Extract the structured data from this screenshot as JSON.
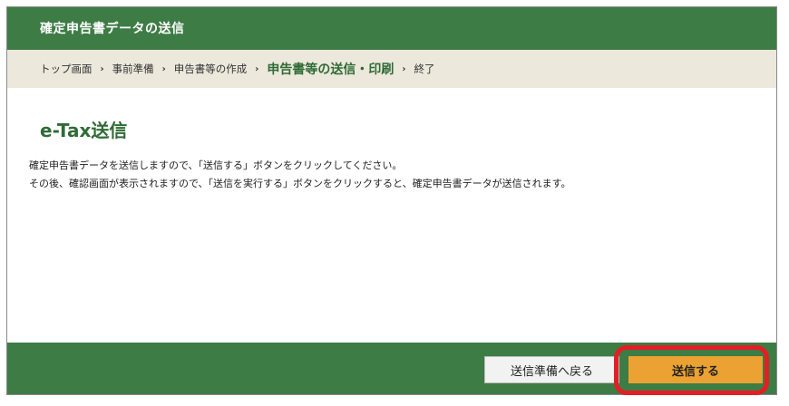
{
  "header": {
    "title": "確定申告書データの送信"
  },
  "breadcrumb": {
    "items": [
      {
        "label": "トップ画面"
      },
      {
        "label": "事前準備"
      },
      {
        "label": "申告書等の作成"
      },
      {
        "label": "申告書等の送信・印刷"
      },
      {
        "label": "終了"
      }
    ],
    "separator": "›",
    "current_index": 3
  },
  "main": {
    "title": "e-Tax送信",
    "paragraphs": [
      "確定申告書データを送信しますので、「送信する」ボタンをクリックしてください。",
      "その後、確認画面が表示されますので、「送信を実行する」ボタンをクリックすると、確定申告書データが送信されます。"
    ]
  },
  "footer": {
    "back_label": "送信準備へ戻る",
    "send_label": "送信する"
  },
  "colors": {
    "header_green": "#3e7c45",
    "title_green": "#2f6b35",
    "breadcrumb_bg": "#ece8dc",
    "send_button": "#eba232",
    "highlight_red": "#e31e24"
  }
}
